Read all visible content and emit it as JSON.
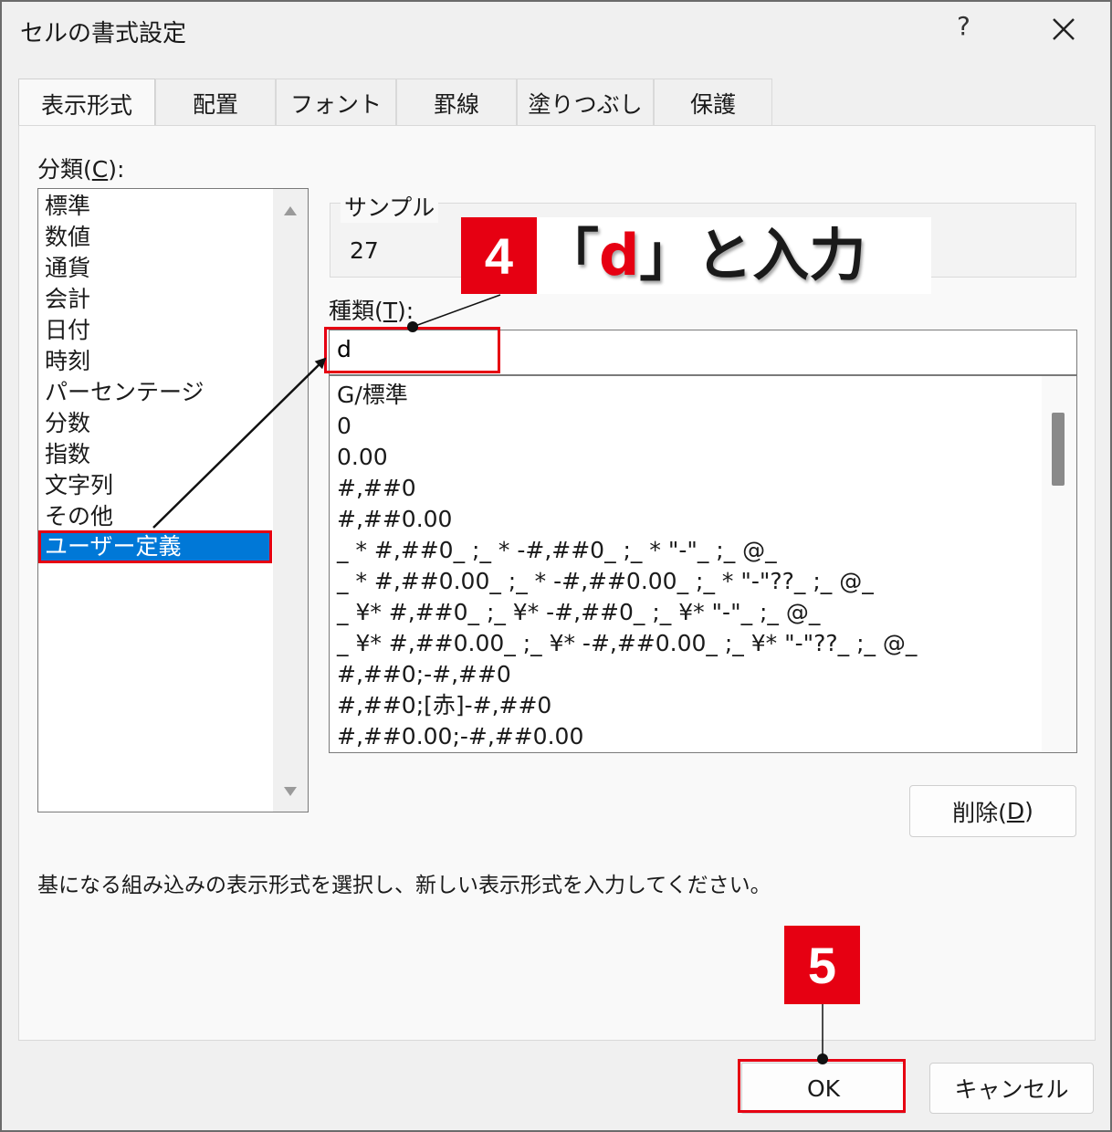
{
  "dialog": {
    "title": "セルの書式設定",
    "help_label": "?"
  },
  "tabs": [
    {
      "label": "表示形式",
      "active": true
    },
    {
      "label": "配置"
    },
    {
      "label": "フォント"
    },
    {
      "label": "罫線"
    },
    {
      "label": "塗りつぶし"
    },
    {
      "label": "保護"
    }
  ],
  "category": {
    "label": "分類(",
    "accesskey": "C",
    "label_end": "):",
    "items": [
      "標準",
      "数値",
      "通貨",
      "会計",
      "日付",
      "時刻",
      "パーセンテージ",
      "分数",
      "指数",
      "文字列",
      "その他",
      "ユーザー定義"
    ],
    "selected": "ユーザー定義"
  },
  "sample": {
    "label": "サンプル",
    "value": "27"
  },
  "type_field": {
    "label": "種類(",
    "accesskey": "T",
    "label_end": "):",
    "value": "d"
  },
  "format_list": [
    "G/標準",
    "0",
    "0.00",
    "#,##0",
    "#,##0.00",
    "_ * #,##0_ ;_ * -#,##0_ ;_ * \"-\"_ ;_ @_",
    "_ * #,##0.00_ ;_ * -#,##0.00_ ;_ * \"-\"??_ ;_ @_",
    "_ ¥* #,##0_ ;_ ¥* -#,##0_ ;_ ¥* \"-\"_ ;_ @_",
    "_ ¥* #,##0.00_ ;_ ¥* -#,##0.00_ ;_ ¥* \"-\"??_ ;_ @_",
    "#,##0;-#,##0",
    "#,##0;[赤]-#,##0",
    "#,##0.00;-#,##0.00"
  ],
  "delete_button": {
    "label": "削除(",
    "accesskey": "D",
    "label_end": ")"
  },
  "description": "基になる組み込みの表示形式を選択し、新しい表示形式を入力してください。",
  "ok_button": {
    "label": "OK"
  },
  "cancel_button": {
    "label": "キャンセル"
  },
  "annotations": {
    "step4_number": "4",
    "step4_open": "「",
    "step4_value": "d",
    "step4_close": "」と入力",
    "step5_number": "5"
  },
  "colors": {
    "accent_red": "#e60012",
    "selection_blue": "#0078d7"
  }
}
